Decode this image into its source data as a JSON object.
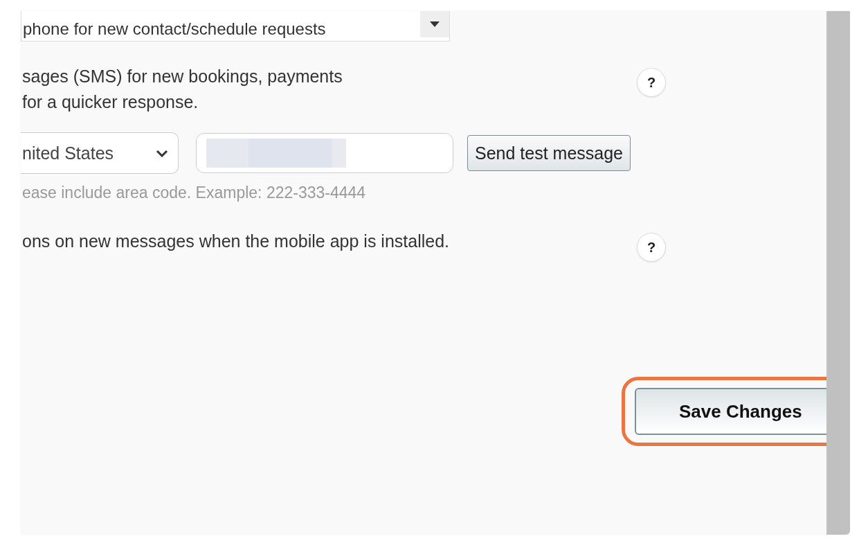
{
  "notification_select": {
    "text": "phone for new contact/schedule requests"
  },
  "sms_section": {
    "description": [
      "sages (SMS) for new bookings, payments",
      "for a quicker response."
    ],
    "help": "?"
  },
  "phone_row": {
    "country": "nited States",
    "phone_redacted": true,
    "send_button": "Send test message",
    "hint": "ease include area code. Example: 222-333-4444"
  },
  "push_section": {
    "description": "ons on new messages when the mobile app is installed.",
    "help": "?"
  },
  "save_button": {
    "label": "Save Changes",
    "highlighted": true
  }
}
